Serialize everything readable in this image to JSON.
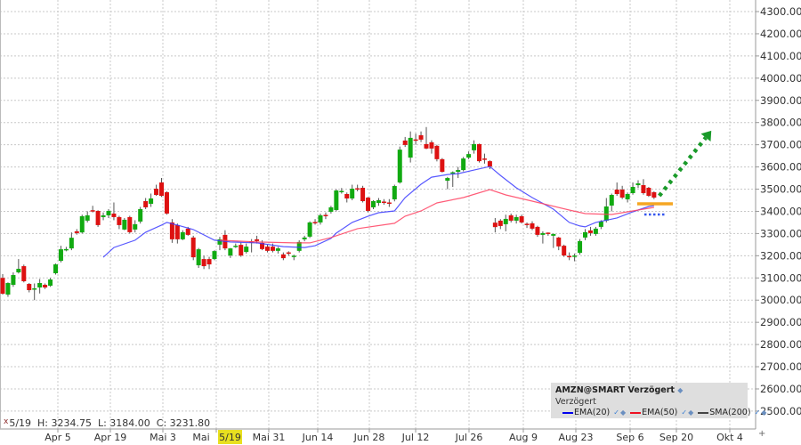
{
  "chart_data": {
    "type": "candlestick",
    "symbol": "AMZN",
    "y_axis": {
      "min": 2500,
      "max": 4300,
      "step": 100,
      "labels": [
        "4300.00",
        "4200.00",
        "4100.00",
        "4000.00",
        "3900.00",
        "3800.00",
        "3700.00",
        "3600.00",
        "3500.00",
        "3400.00",
        "3300.00",
        "3200.00",
        "3100.00",
        "3000.00",
        "2900.00",
        "2800.00",
        "2700.00",
        "2600.00",
        "2500.00"
      ]
    },
    "x_axis": {
      "labels": [
        "Apr 5",
        "Apr 19",
        "Mai 3",
        "Mai",
        "Mai 31",
        "Jun 14",
        "Jun 28",
        "Jul 12",
        "Jul 26",
        "Aug 9",
        "Aug 23",
        "Sep 6",
        "Sep 20",
        "Okt 4"
      ],
      "crosshair_label": "5/19"
    },
    "grid": true,
    "candles_ohlc": [
      [
        3100,
        3117,
        3025,
        3029
      ],
      [
        3025,
        3080,
        3015,
        3077
      ],
      [
        3069,
        3125,
        3060,
        3113
      ],
      [
        3125,
        3185,
        3120,
        3141
      ],
      [
        3153,
        3160,
        3080,
        3085
      ],
      [
        3073,
        3077,
        3035,
        3045
      ],
      [
        3050,
        3075,
        3000,
        3053
      ],
      [
        3057,
        3095,
        3030,
        3077
      ],
      [
        3069,
        3075,
        3050,
        3057
      ],
      [
        3065,
        3100,
        3060,
        3093
      ],
      [
        3121,
        3165,
        3115,
        3161
      ],
      [
        3177,
        3245,
        3170,
        3229
      ],
      [
        3225,
        3240,
        3220,
        3230
      ],
      [
        3233,
        3305,
        3225,
        3281
      ],
      [
        3310,
        3320,
        3295,
        3302
      ],
      [
        3305,
        3385,
        3300,
        3378
      ],
      [
        3358,
        3400,
        3350,
        3382
      ],
      [
        3405,
        3425,
        3395,
        3400
      ],
      [
        3402,
        3405,
        3330,
        3338
      ],
      [
        3374,
        3395,
        3360,
        3382
      ],
      [
        3382,
        3410,
        3370,
        3402
      ],
      [
        3390,
        3440,
        3360,
        3374
      ],
      [
        3374,
        3380,
        3320,
        3338
      ],
      [
        3318,
        3370,
        3315,
        3362
      ],
      [
        3374,
        3380,
        3300,
        3306
      ],
      [
        3318,
        3360,
        3305,
        3342
      ],
      [
        3354,
        3420,
        3345,
        3410
      ],
      [
        3446,
        3460,
        3410,
        3418
      ],
      [
        3434,
        3480,
        3420,
        3458
      ],
      [
        3502,
        3520,
        3470,
        3474
      ],
      [
        3530,
        3550,
        3465,
        3470
      ],
      [
        3486,
        3490,
        3385,
        3390
      ],
      [
        3350,
        3365,
        3258,
        3274
      ],
      [
        3338,
        3345,
        3255,
        3274
      ],
      [
        3274,
        3315,
        3270,
        3306
      ],
      [
        3322,
        3330,
        3290,
        3294
      ],
      [
        3282,
        3290,
        3180,
        3193
      ],
      [
        3157,
        3235,
        3145,
        3229
      ],
      [
        3185,
        3200,
        3140,
        3153
      ],
      [
        3185,
        3195,
        3140,
        3161
      ],
      [
        3185,
        3225,
        3180,
        3221
      ],
      [
        3250,
        3285,
        3225,
        3274
      ],
      [
        3294,
        3315,
        3225,
        3233
      ],
      [
        3201,
        3235,
        3190,
        3233
      ],
      [
        3241,
        3255,
        3235,
        3245
      ],
      [
        3249,
        3260,
        3195,
        3201
      ],
      [
        3217,
        3255,
        3210,
        3241
      ],
      [
        3265,
        3275,
        3215,
        3262
      ],
      [
        3274,
        3290,
        3255,
        3266
      ],
      [
        3258,
        3270,
        3225,
        3230
      ],
      [
        3241,
        3250,
        3215,
        3222
      ],
      [
        3241,
        3255,
        3215,
        3222
      ],
      [
        3222,
        3240,
        3210,
        3233
      ],
      [
        3206,
        3215,
        3180,
        3189
      ],
      [
        3215,
        3220,
        3200,
        3209
      ],
      [
        3197,
        3205,
        3180,
        3200
      ],
      [
        3222,
        3270,
        3215,
        3262
      ],
      [
        3274,
        3290,
        3265,
        3282
      ],
      [
        3286,
        3355,
        3280,
        3350
      ],
      [
        3352,
        3365,
        3340,
        3349
      ],
      [
        3350,
        3390,
        3340,
        3382
      ],
      [
        3384,
        3395,
        3365,
        3380
      ],
      [
        3398,
        3425,
        3390,
        3418
      ],
      [
        3406,
        3500,
        3400,
        3494
      ],
      [
        3488,
        3505,
        3480,
        3492
      ],
      [
        3478,
        3485,
        3440,
        3458
      ],
      [
        3458,
        3520,
        3450,
        3502
      ],
      [
        3504,
        3520,
        3490,
        3500
      ],
      [
        3506,
        3515,
        3440,
        3446
      ],
      [
        3462,
        3465,
        3395,
        3402
      ],
      [
        3418,
        3450,
        3410,
        3446
      ],
      [
        3438,
        3460,
        3425,
        3450
      ],
      [
        3444,
        3455,
        3430,
        3440
      ],
      [
        3440,
        3455,
        3420,
        3436
      ],
      [
        3454,
        3520,
        3445,
        3514
      ],
      [
        3530,
        3692,
        3525,
        3678
      ],
      [
        3719,
        3735,
        3690,
        3699
      ],
      [
        3642,
        3760,
        3620,
        3731
      ],
      [
        3724,
        3750,
        3700,
        3720
      ],
      [
        3743,
        3760,
        3712,
        3723
      ],
      [
        3703,
        3780,
        3680,
        3683
      ],
      [
        3711,
        3720,
        3660,
        3683
      ],
      [
        3695,
        3700,
        3625,
        3635
      ],
      [
        3635,
        3640,
        3575,
        3578
      ],
      [
        3538,
        3555,
        3500,
        3550
      ],
      [
        3572,
        3580,
        3510,
        3576
      ],
      [
        3578,
        3600,
        3550,
        3586
      ],
      [
        3586,
        3645,
        3580,
        3638
      ],
      [
        3642,
        3670,
        3635,
        3658
      ],
      [
        3675,
        3720,
        3660,
        3703
      ],
      [
        3703,
        3705,
        3620,
        3626
      ],
      [
        3638,
        3660,
        3615,
        3634
      ],
      [
        3626,
        3630,
        3590,
        3602
      ],
      [
        3349,
        3370,
        3305,
        3329
      ],
      [
        3358,
        3365,
        3320,
        3334
      ],
      [
        3342,
        3385,
        3310,
        3366
      ],
      [
        3382,
        3390,
        3350,
        3358
      ],
      [
        3358,
        3385,
        3345,
        3374
      ],
      [
        3378,
        3385,
        3345,
        3350
      ],
      [
        3344,
        3350,
        3325,
        3340
      ],
      [
        3346,
        3355,
        3315,
        3322
      ],
      [
        3330,
        3335,
        3285,
        3294
      ],
      [
        3294,
        3310,
        3255,
        3302
      ],
      [
        3304,
        3305,
        3290,
        3300
      ],
      [
        3290,
        3300,
        3235,
        3298
      ],
      [
        3282,
        3285,
        3225,
        3242
      ],
      [
        3245,
        3250,
        3195,
        3201
      ],
      [
        3199,
        3215,
        3180,
        3195
      ],
      [
        3197,
        3210,
        3175,
        3201
      ],
      [
        3213,
        3275,
        3205,
        3266
      ],
      [
        3282,
        3320,
        3270,
        3306
      ],
      [
        3314,
        3330,
        3290,
        3302
      ],
      [
        3298,
        3330,
        3290,
        3322
      ],
      [
        3330,
        3360,
        3320,
        3354
      ],
      [
        3358,
        3460,
        3350,
        3422
      ],
      [
        3426,
        3480,
        3400,
        3474
      ],
      [
        3498,
        3530,
        3470,
        3478
      ],
      [
        3498,
        3515,
        3455,
        3462
      ],
      [
        3454,
        3485,
        3440,
        3478
      ],
      [
        3482,
        3530,
        3475,
        3510
      ],
      [
        3518,
        3540,
        3505,
        3526
      ],
      [
        3518,
        3545,
        3475,
        3482
      ],
      [
        3506,
        3510,
        3465,
        3470
      ],
      [
        3486,
        3490,
        3455,
        3462
      ]
    ],
    "series": [
      {
        "name": "EMA(20)",
        "color": "#3b3bff",
        "points": [
          [
            19,
            3193
          ],
          [
            21,
            3237
          ],
          [
            25,
            3270
          ],
          [
            27,
            3306
          ],
          [
            30,
            3338
          ],
          [
            31,
            3350
          ],
          [
            33,
            3338
          ],
          [
            36,
            3318
          ],
          [
            40,
            3270
          ],
          [
            43,
            3262
          ],
          [
            48,
            3258
          ],
          [
            53,
            3241
          ],
          [
            57,
            3237
          ],
          [
            59,
            3245
          ],
          [
            62,
            3278
          ],
          [
            63,
            3302
          ],
          [
            66,
            3350
          ],
          [
            69,
            3378
          ],
          [
            71,
            3394
          ],
          [
            74,
            3402
          ],
          [
            76,
            3462
          ],
          [
            79,
            3522
          ],
          [
            81,
            3554
          ],
          [
            84,
            3566
          ],
          [
            86,
            3570
          ],
          [
            89,
            3586
          ],
          [
            92,
            3602
          ],
          [
            94,
            3562
          ],
          [
            97,
            3506
          ],
          [
            100,
            3462
          ],
          [
            104,
            3410
          ],
          [
            107,
            3350
          ],
          [
            109,
            3334
          ],
          [
            110,
            3330
          ],
          [
            112,
            3350
          ],
          [
            116,
            3370
          ],
          [
            119,
            3398
          ],
          [
            122,
            3422
          ],
          [
            123,
            3426
          ]
        ]
      },
      {
        "name": "EMA(50)",
        "color": "#ff4060",
        "points": [
          [
            41,
            3270
          ],
          [
            48,
            3262
          ],
          [
            55,
            3258
          ],
          [
            58,
            3258
          ],
          [
            62,
            3282
          ],
          [
            67,
            3322
          ],
          [
            74,
            3346
          ],
          [
            76,
            3378
          ],
          [
            79,
            3402
          ],
          [
            82,
            3438
          ],
          [
            87,
            3462
          ],
          [
            92,
            3498
          ],
          [
            95,
            3474
          ],
          [
            100,
            3446
          ],
          [
            107,
            3406
          ],
          [
            110,
            3390
          ],
          [
            115,
            3386
          ],
          [
            120,
            3406
          ],
          [
            123,
            3418
          ]
        ]
      }
    ],
    "annotations": {
      "support_level": 3434,
      "dotted_level": 3386,
      "trend_arrow": {
        "from": [
          124,
          3470
        ],
        "to": [
          134,
          3760
        ],
        "color": "#1a9a2a"
      },
      "support_color": "#f5a623"
    },
    "candle_colors": {
      "up": "#11aa11",
      "down": "#dd1111",
      "wick": "#555555"
    }
  },
  "info_bar": {
    "marker": "x",
    "text": "5/19  H: 3234.75  L: 3184.00  C: 3231.80"
  },
  "legend": {
    "title": "AMZN@SMART Verzögert",
    "subtitle": "Verzögert",
    "items": [
      {
        "label": "EMA(20)",
        "color": "#0000ee"
      },
      {
        "label": "EMA(50)",
        "color": "#ee1122"
      },
      {
        "label": "SMA(200)",
        "color": "#444444"
      }
    ],
    "check": "✓",
    "dot": "◆"
  },
  "corner": "+"
}
